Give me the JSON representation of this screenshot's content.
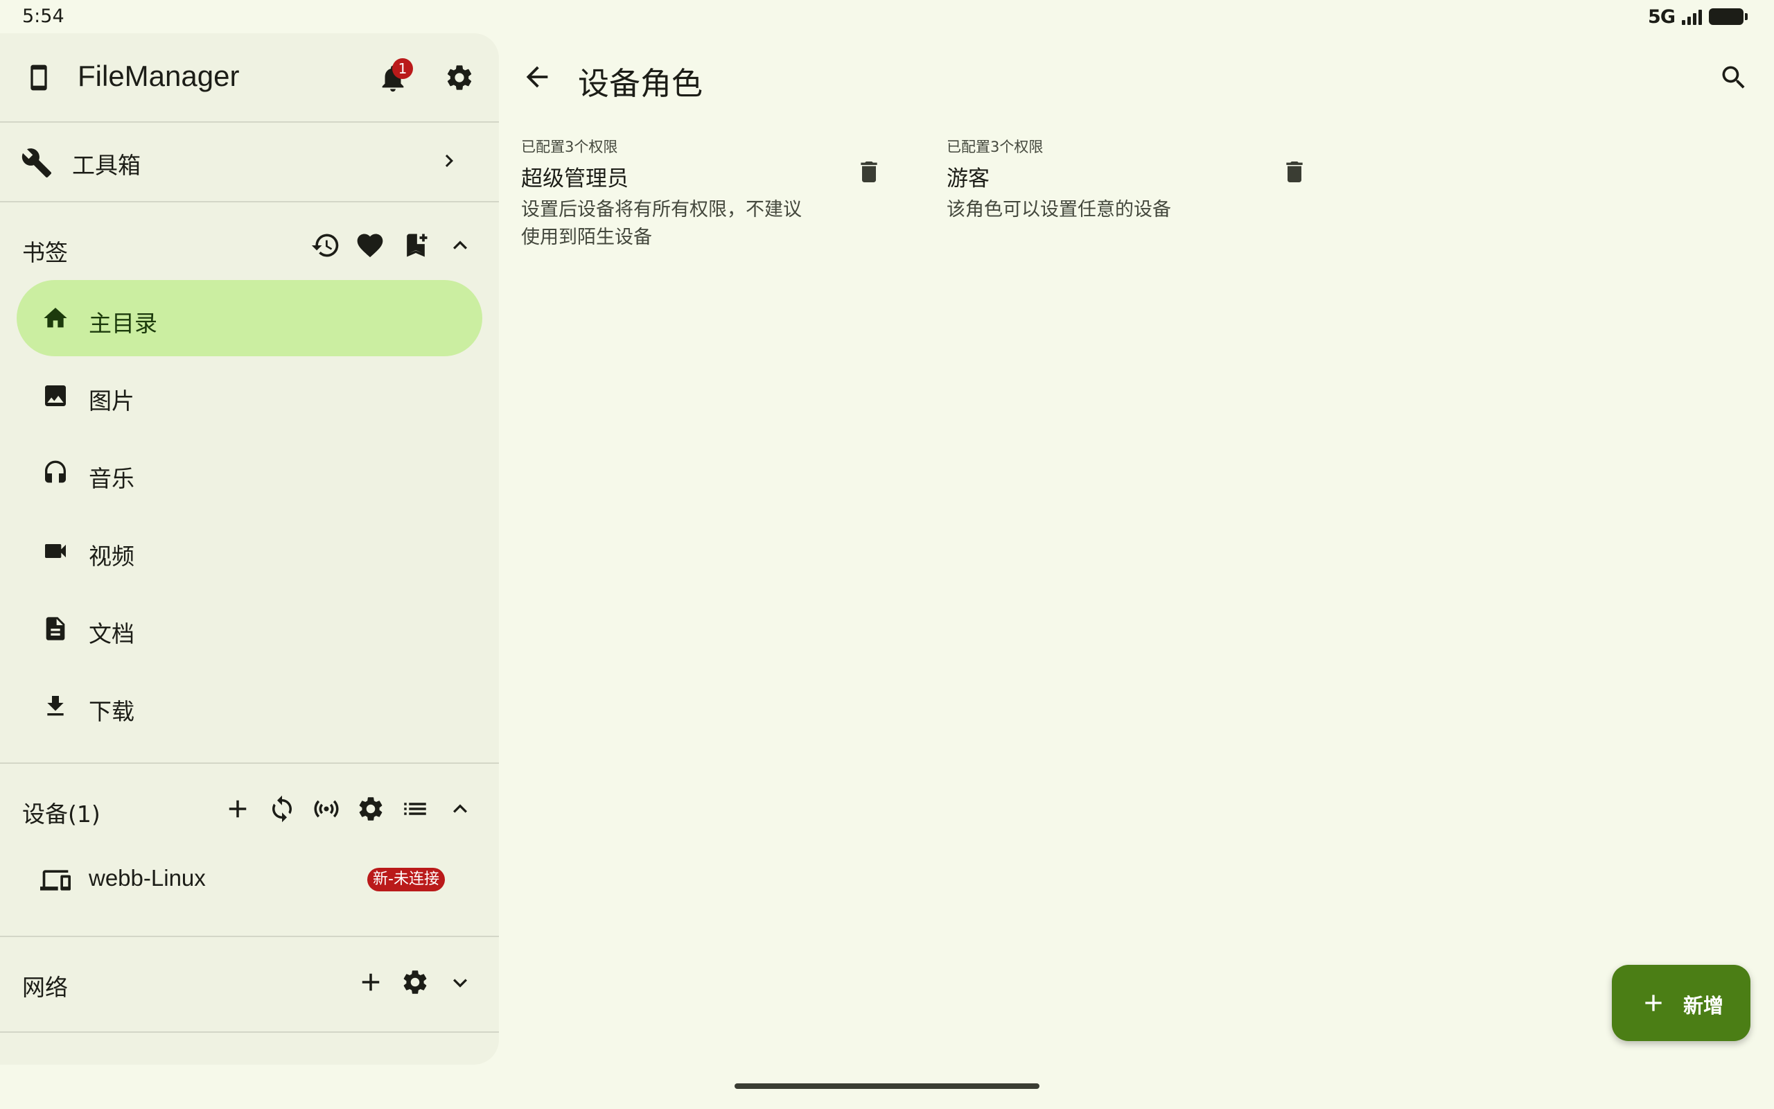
{
  "status_bar": {
    "time": "5:54",
    "network": "5G"
  },
  "drawer": {
    "app_title": "FileManager",
    "notification_count": "1",
    "toolbox": {
      "label": "工具箱"
    },
    "bookmarks": {
      "title": "书签",
      "items": [
        {
          "label": "主目录",
          "icon": "home-icon",
          "active": true
        },
        {
          "label": "图片",
          "icon": "image-icon",
          "active": false
        },
        {
          "label": "音乐",
          "icon": "headphones-icon",
          "active": false
        },
        {
          "label": "视频",
          "icon": "videocam-icon",
          "active": false
        },
        {
          "label": "文档",
          "icon": "document-icon",
          "active": false
        },
        {
          "label": "下载",
          "icon": "download-icon",
          "active": false
        }
      ]
    },
    "devices": {
      "title": "设备(1)",
      "items": [
        {
          "name": "webb-Linux",
          "badge": "新-未连接"
        }
      ]
    },
    "network": {
      "title": "网络"
    }
  },
  "main": {
    "title": "设备角色",
    "roles": [
      {
        "meta": "已配置3个权限",
        "name": "超级管理员",
        "description": "设置后设备将有所有权限，不建议使用到陌生设备"
      },
      {
        "meta": "已配置3个权限",
        "name": "游客",
        "description": "该角色可以设置任意的设备"
      }
    ],
    "fab_label": "新增"
  },
  "colors": {
    "background": "#f6f9ea",
    "drawer": "#eff2e2",
    "active_item": "#cbeea1",
    "fab": "#4b7e15",
    "badge": "#ba1a1a"
  }
}
